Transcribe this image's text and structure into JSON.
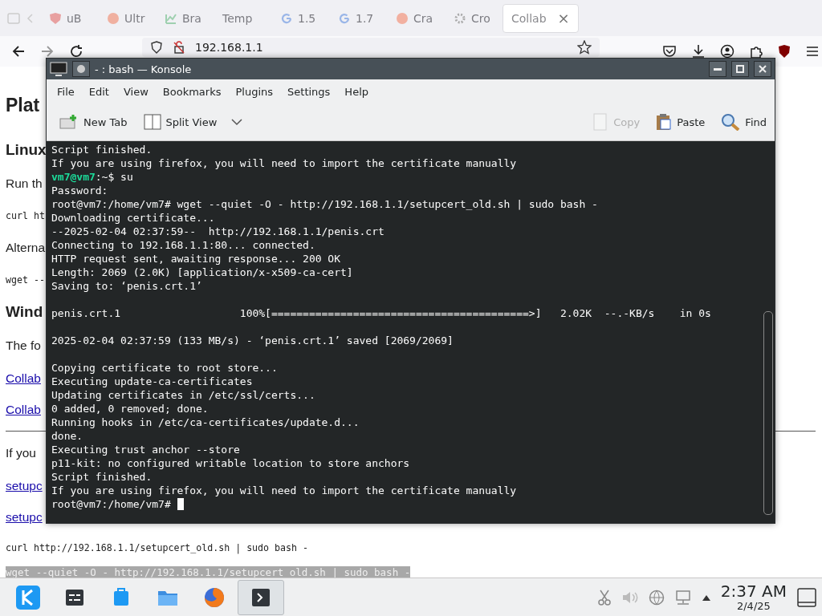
{
  "browser": {
    "tabs": [
      {
        "label": "uB",
        "selected": false
      },
      {
        "label": "Ultr",
        "selected": false
      },
      {
        "label": "Bra",
        "selected": false
      },
      {
        "label": "Temp",
        "selected": false
      },
      {
        "label": "1.5",
        "selected": false
      },
      {
        "label": "1.7",
        "selected": false
      },
      {
        "label": "Cra",
        "selected": false
      },
      {
        "label": "Cro",
        "selected": false
      },
      {
        "label": "Collab",
        "selected": true
      }
    ],
    "close_glyph": "×",
    "address": "192.168.1.1",
    "page": [
      {
        "kind": "h1",
        "text": "Plat"
      },
      {
        "kind": "h2",
        "text": "Linux"
      },
      {
        "kind": "p",
        "text": "Run th"
      },
      {
        "kind": "code",
        "text": "curl ht"
      },
      {
        "kind": "p",
        "text": "Alterna"
      },
      {
        "kind": "code",
        "text": "wget --"
      },
      {
        "kind": "h2",
        "text": "Wind"
      },
      {
        "kind": "p",
        "text": "The fo"
      },
      {
        "kind": "link",
        "text": "Collab"
      },
      {
        "kind": "link",
        "text": "Collab"
      },
      {
        "kind": "hr"
      },
      {
        "kind": "p",
        "text": "If you"
      },
      {
        "kind": "link",
        "text": "setupc"
      },
      {
        "kind": "link",
        "text": "setupc"
      },
      {
        "kind": "code",
        "text": "curl http://192.168.1.1/setupcert_old.sh | sudo bash -"
      },
      {
        "kind": "code_selected",
        "text": "wget --quiet -O - http://192.168.1.1/setupcert_old.sh | sudo bash -"
      }
    ]
  },
  "konsole": {
    "title": "- : bash — Konsole",
    "menu": [
      "File",
      "Edit",
      "View",
      "Bookmarks",
      "Plugins",
      "Settings",
      "Help"
    ],
    "toolbar": [
      {
        "label": "New Tab",
        "disabled": false
      },
      {
        "label": "Split View",
        "disabled": false
      },
      {
        "label": "Copy",
        "disabled": true
      },
      {
        "label": "Paste",
        "disabled": false
      },
      {
        "label": "Find",
        "disabled": false
      }
    ],
    "lines": [
      {
        "text": "Script finished."
      },
      {
        "text": "If you are using firefox, you will need to import the certificate manually"
      },
      {
        "prompt": "vm7@vm7",
        "text": ":~$ su"
      },
      {
        "text": "Password:"
      },
      {
        "text": "root@vm7:/home/vm7# wget --quiet -O - http://192.168.1.1/setupcert_old.sh | sudo bash -"
      },
      {
        "text": "Downloading certificate..."
      },
      {
        "text": "--2025-02-04 02:37:59--  http://192.168.1.1/penis.crt"
      },
      {
        "text": "Connecting to 192.168.1.1:80... connected."
      },
      {
        "text": "HTTP request sent, awaiting response... 200 OK"
      },
      {
        "text": "Length: 2069 (2.0K) [application/x-x509-ca-cert]"
      },
      {
        "text": "Saving to: ‘penis.crt.1’"
      },
      {
        "text": "penis.crt.1                   100%[=========================================>]   2.02K  --.-KB/s    in 0s",
        "gap_before": true
      },
      {
        "text": "2025-02-04 02:37:59 (133 MB/s) - ‘penis.crt.1’ saved [2069/2069]",
        "gap_before": true
      },
      {
        "text": "Copying certificate to root store...",
        "gap_before": true
      },
      {
        "text": "Executing update-ca-certificates"
      },
      {
        "text": "Updating certificates in /etc/ssl/certs..."
      },
      {
        "text": "0 added, 0 removed; done."
      },
      {
        "text": "Running hooks in /etc/ca-certificates/update.d..."
      },
      {
        "text": "done."
      },
      {
        "text": "Executing trust anchor --store"
      },
      {
        "text": "p11-kit: no configured writable location to store anchors"
      },
      {
        "text": "Script finished."
      },
      {
        "text": "If you are using firefox, you will need to import the certificate manually"
      },
      {
        "text": "root@vm7:/home/vm7# ",
        "cursor": true
      }
    ]
  },
  "taskbar": {
    "tasks": [
      {
        "kind": "launcher",
        "selected": false
      },
      {
        "kind": "monitor",
        "selected": false
      },
      {
        "kind": "store",
        "selected": false
      },
      {
        "kind": "folder",
        "selected": false
      },
      {
        "kind": "browser",
        "selected": false
      },
      {
        "kind": "terminal",
        "selected": true
      }
    ],
    "time": "2:37 AM",
    "date": "2/4/25"
  }
}
